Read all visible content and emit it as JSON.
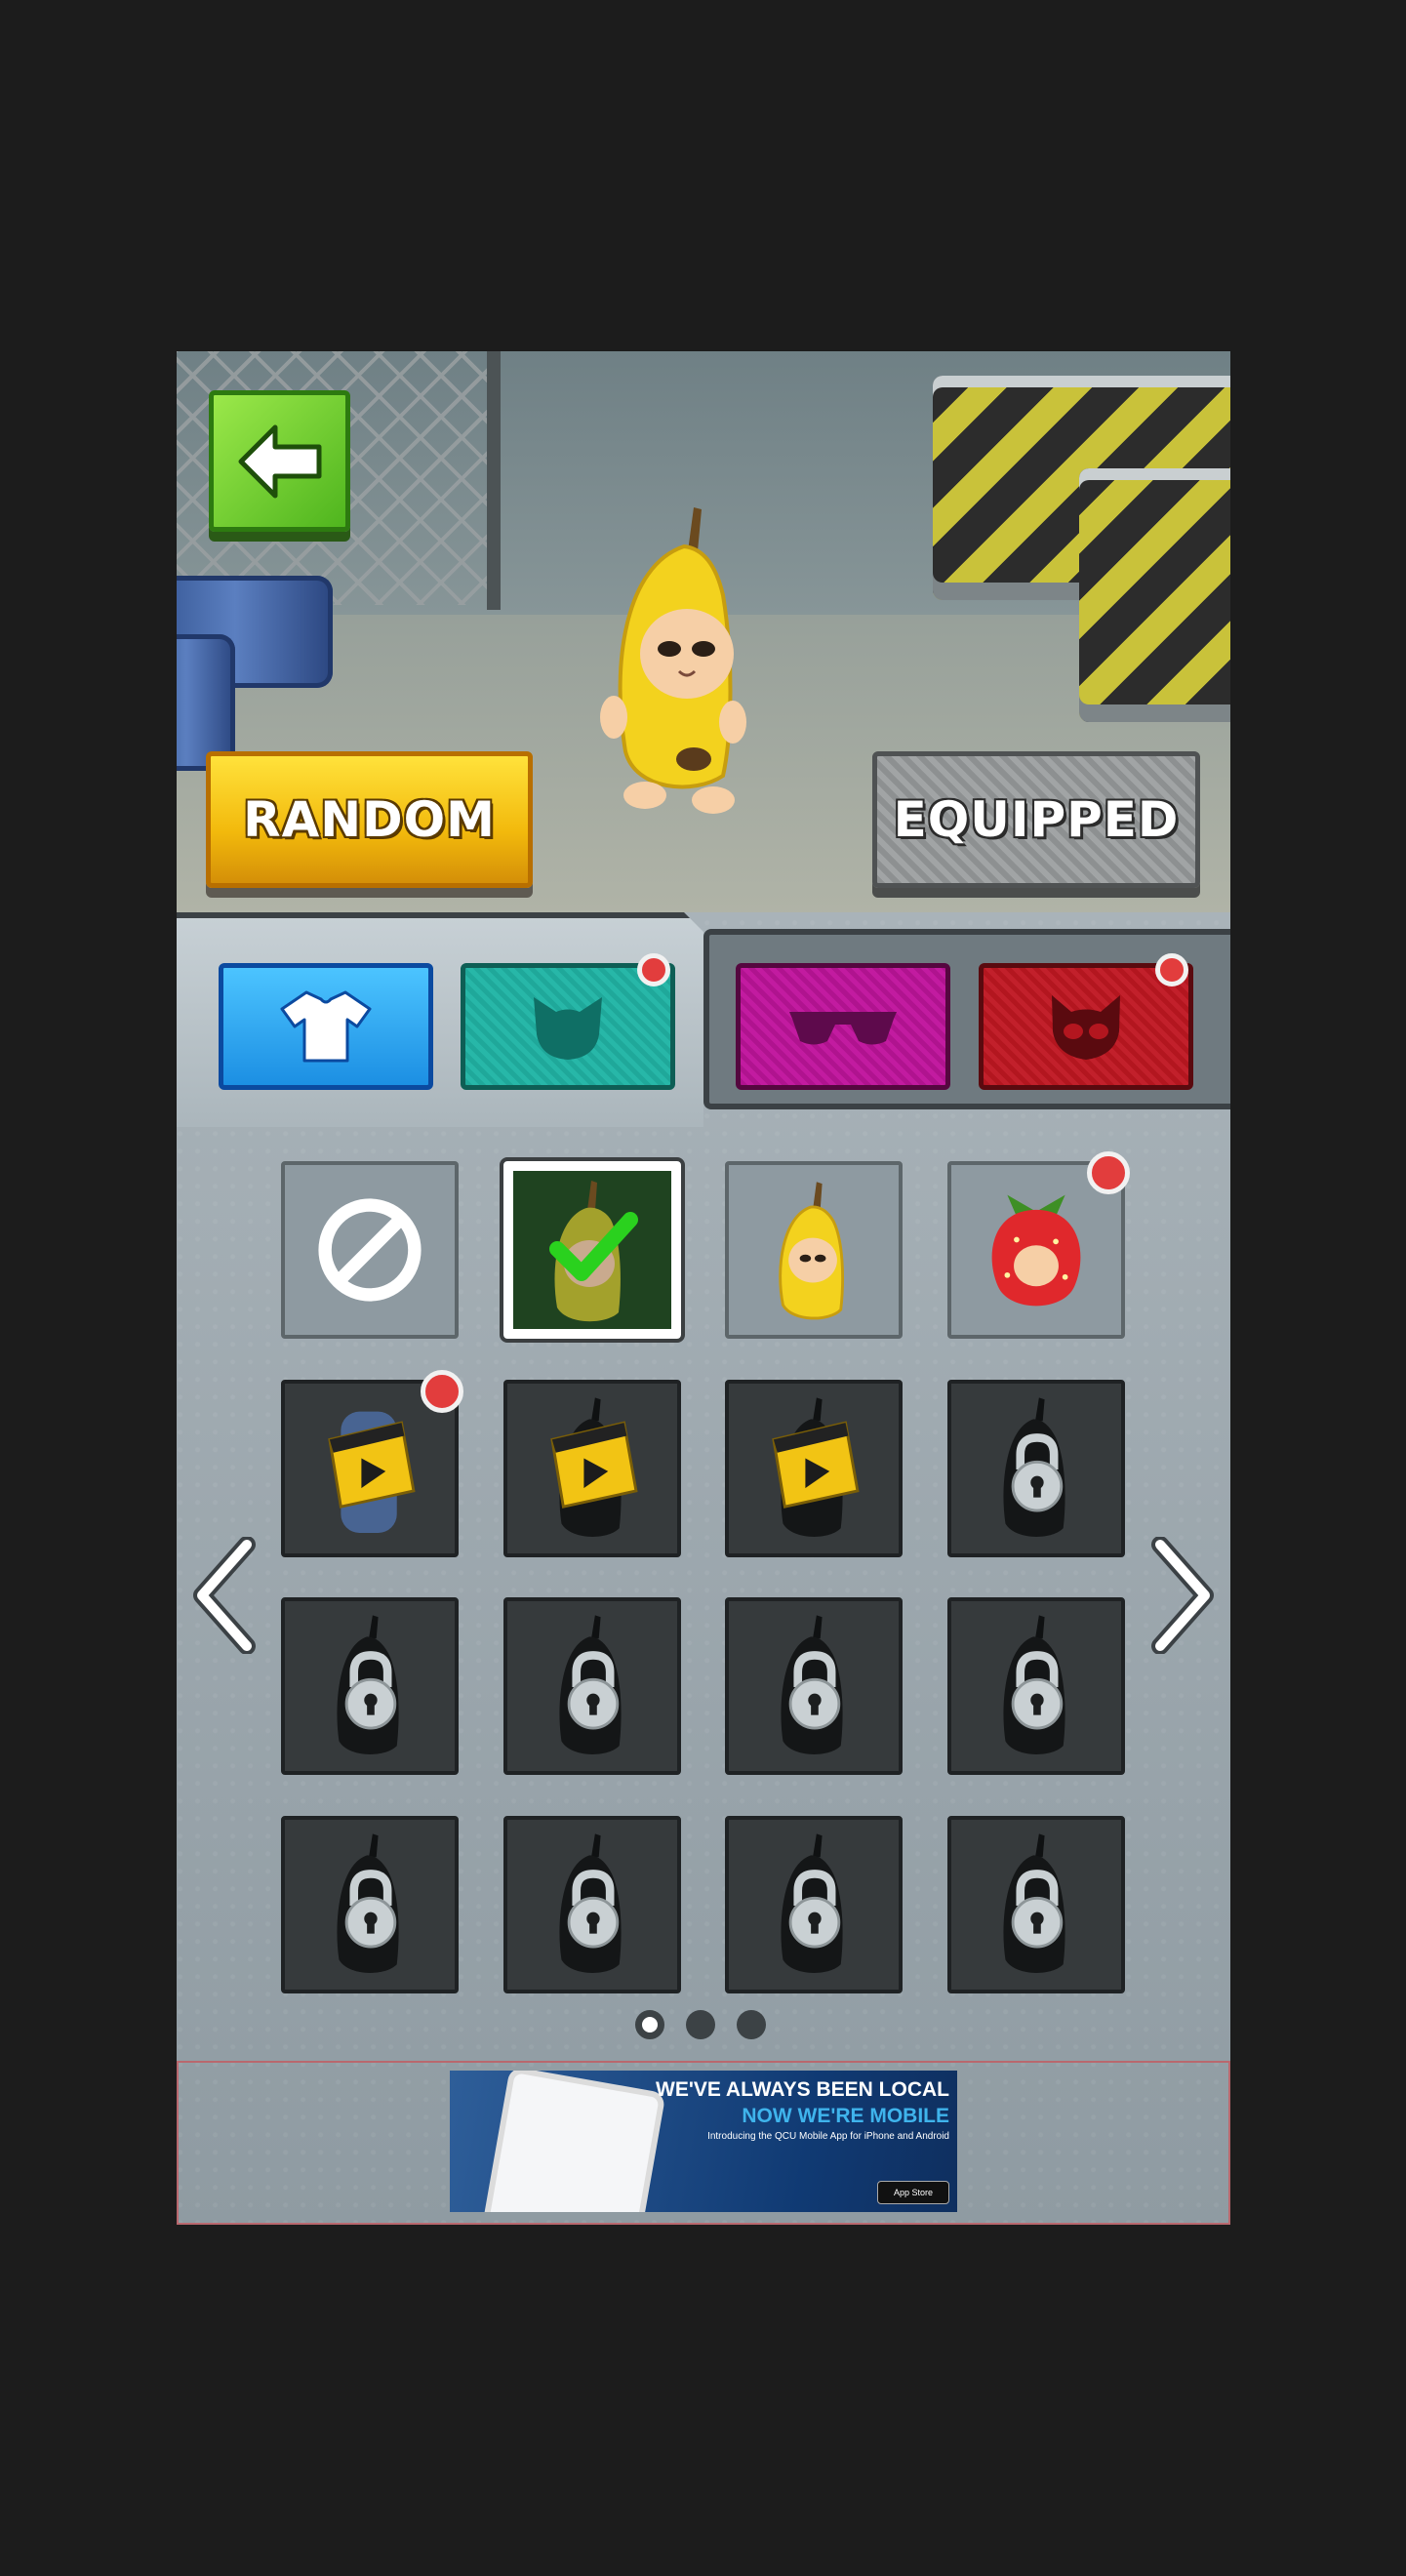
{
  "header": {
    "back_icon": "arrow-left-icon",
    "random_label": "RANDOM",
    "equipped_label": "EQUIPPED"
  },
  "tabs": [
    {
      "id": "outfit",
      "icon": "tshirt-icon",
      "color": "#1c8fe3",
      "active": true,
      "badge": false
    },
    {
      "id": "head",
      "icon": "cat-head-icon",
      "color": "#1fa89a",
      "active": false,
      "badge": true
    },
    {
      "id": "glasses",
      "icon": "sunglasses-icon",
      "color": "#b0138f",
      "active": false,
      "badge": false
    },
    {
      "id": "mask",
      "icon": "cat-skull-icon",
      "color": "#b3161f",
      "active": false,
      "badge": true
    }
  ],
  "grid": {
    "rows": [
      [
        "none",
        "selected-banana",
        "banana",
        "strawberry"
      ],
      [
        "video-blue",
        "video",
        "video",
        "locked"
      ],
      [
        "locked",
        "locked",
        "locked",
        "locked"
      ],
      [
        "locked",
        "locked",
        "locked",
        "locked"
      ]
    ],
    "badges": [
      [
        false,
        false,
        false,
        true
      ],
      [
        true,
        false,
        false,
        false
      ],
      [
        false,
        false,
        false,
        false
      ],
      [
        false,
        false,
        false,
        false
      ]
    ]
  },
  "pager": {
    "pages": 3,
    "current": 1
  },
  "ad": {
    "headline": "WE'VE ALWAYS BEEN LOCAL",
    "subheadline": "NOW WE'RE MOBILE",
    "body": "Introducing the QCU Mobile App for iPhone and Android",
    "store": "App Store"
  },
  "colors": {
    "accent_green": "#4fb51e",
    "accent_yellow": "#f2b90c",
    "badge_red": "#e23d3d"
  }
}
